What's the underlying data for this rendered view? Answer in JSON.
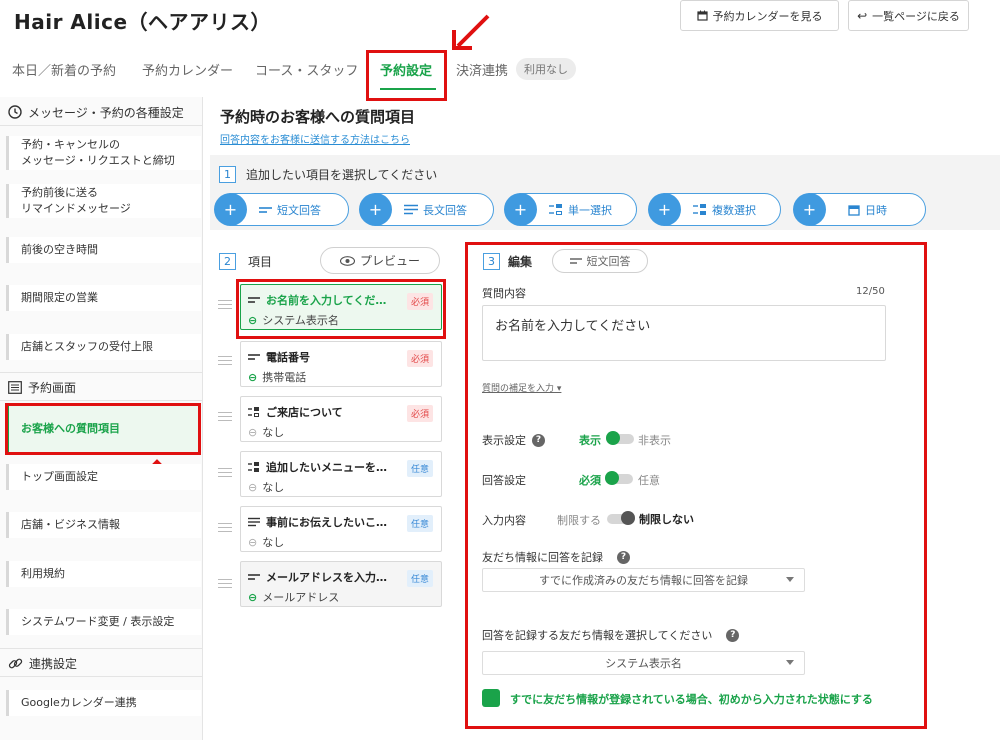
{
  "header": {
    "title": "Hair Alice（ヘアアリス）",
    "calendar_button": "予約カレンダーを見る",
    "back_button": "一覧ページに戻る"
  },
  "tabs": [
    {
      "label": "本日／新着の予約"
    },
    {
      "label": "予約カレンダー"
    },
    {
      "label": "コース・スタッフ"
    },
    {
      "label": "予約設定"
    },
    {
      "label": "決済連携"
    }
  ],
  "tab_pill": "利用なし",
  "sidebar": {
    "section1": "メッセージ・予約の各種設定",
    "items1": [
      {
        "line1": "予約・キャンセルの",
        "line2": "メッセージ・リクエストと締切"
      },
      {
        "line1": "予約前後に送る",
        "line2": "リマインドメッセージ"
      },
      {
        "line1": "前後の空き時間",
        "line2": ""
      },
      {
        "line1": "期間限定の営業",
        "line2": ""
      },
      {
        "line1": "店舗とスタッフの受付上限",
        "line2": ""
      }
    ],
    "section2": "予約画面",
    "items2": [
      {
        "label": "お客様への質問項目"
      },
      {
        "label": "トップ画面設定"
      },
      {
        "label": "店舗・ビジネス情報"
      },
      {
        "label": "利用規約"
      },
      {
        "label": "システムワード変更 / 表示設定"
      }
    ],
    "section3": "連携設定",
    "items3": [
      {
        "label": "Googleカレンダー連携"
      }
    ]
  },
  "main": {
    "title": "予約時のお客様への質問項目",
    "help_link": "回答内容をお客様に送信する方法はこちら",
    "step1": {
      "num": "1",
      "label": "追加したい項目を選択してください"
    },
    "add_buttons": [
      {
        "label": "短文回答",
        "icon": "short-text-icon"
      },
      {
        "label": "長文回答",
        "icon": "long-text-icon"
      },
      {
        "label": "単一選択",
        "icon": "single-select-icon"
      },
      {
        "label": "複数選択",
        "icon": "multi-select-icon"
      },
      {
        "label": "日時",
        "icon": "calendar-icon"
      }
    ],
    "step2": {
      "num": "2",
      "label": "項目"
    },
    "preview_button": "プレビュー",
    "questions": [
      {
        "title": "お名前を入力してくだ…",
        "badge": "必須",
        "link": "システム表示名"
      },
      {
        "title": "電話番号",
        "badge": "必須",
        "link": "携帯電話"
      },
      {
        "title": "ご来店について",
        "badge": "必須",
        "link": "なし"
      },
      {
        "title": "追加したいメニューを…",
        "badge": "任意",
        "link": "なし"
      },
      {
        "title": "事前にお伝えしたいこ…",
        "badge": "任意",
        "link": "なし"
      },
      {
        "title": "メールアドレスを入力…",
        "badge": "任意",
        "link": "メールアドレス"
      }
    ],
    "step3": {
      "num": "3",
      "label": "編集"
    },
    "type_pill": "短文回答"
  },
  "editor": {
    "question_label": "質問内容",
    "char_count": "12/50",
    "question_value": "お名前を入力してください",
    "supplement_link": "質問の補足を入力",
    "display_label": "表示設定",
    "display_on": "表示",
    "display_off": "非表示",
    "answer_label": "回答設定",
    "answer_on": "必須",
    "answer_off": "任意",
    "input_label": "入力内容",
    "input_on": "制限する",
    "input_off": "制限しない",
    "friend_label": "友だち情報に回答を記録",
    "friend_select": "すでに作成済みの友だち情報に回答を記録",
    "record_label": "回答を記録する友だち情報を選択してください",
    "record_select": "システム表示名",
    "checkbox_label": "すでに友だち情報が登録されている場合、初めから入力された状態にする"
  },
  "colors": {
    "accent": "#1aa34a",
    "blue": "#3f9ae0",
    "annotation": "#e01010"
  }
}
